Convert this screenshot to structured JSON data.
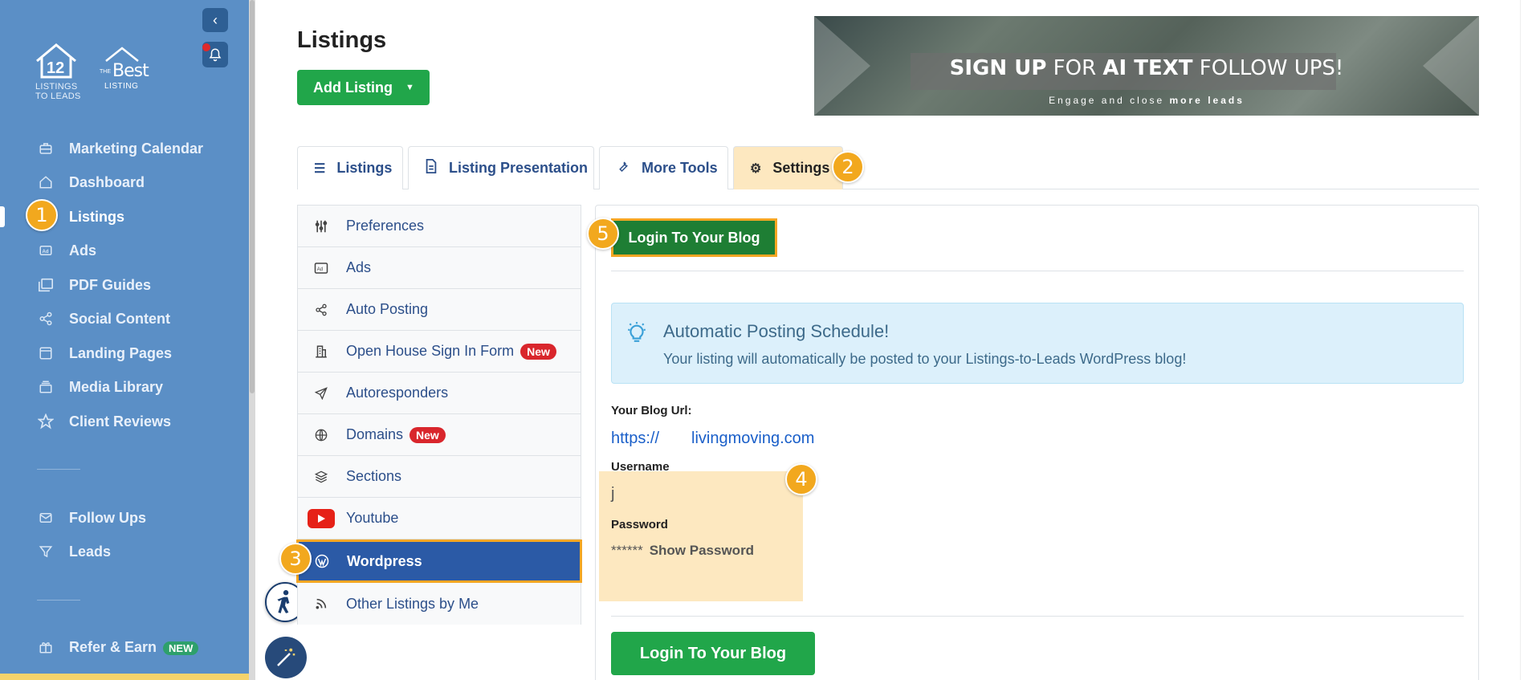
{
  "sidebar": {
    "logo_primary": {
      "number": "12",
      "line1": "LISTINGS",
      "line2": "TO LEADS"
    },
    "logo_secondary": {
      "the": "THE",
      "best": "Best",
      "listing": "LISTING"
    },
    "items": [
      {
        "label": "Marketing Calendar",
        "icon": "briefcase-icon"
      },
      {
        "label": "Dashboard",
        "icon": "home-icon"
      },
      {
        "label": "Listings",
        "icon": "listings-icon"
      },
      {
        "label": "Ads",
        "icon": "ad-icon"
      },
      {
        "label": "PDF Guides",
        "icon": "pdf-icon"
      },
      {
        "label": "Social Content",
        "icon": "share-icon"
      },
      {
        "label": "Landing Pages",
        "icon": "page-icon"
      },
      {
        "label": "Media Library",
        "icon": "folder-icon"
      },
      {
        "label": "Client Reviews",
        "icon": "star-icon"
      },
      {
        "label": "Follow Ups",
        "icon": "mail-icon"
      },
      {
        "label": "Leads",
        "icon": "filter-icon"
      },
      {
        "label": "Refer & Earn",
        "icon": "gift-icon",
        "badge": "NEW"
      }
    ],
    "active_item": "Listings"
  },
  "header": {
    "title": "Listings",
    "add_button": "Add Listing"
  },
  "banner": {
    "headline_bold1": "SIGN UP",
    "headline_mid": " FOR ",
    "headline_bold2": "AI TEXT",
    "headline_end": " FOLLOW UPS!",
    "sub_prefix": "Engage and close ",
    "sub_bold": "more leads"
  },
  "tabs": [
    {
      "label": "Listings",
      "icon": "list-icon"
    },
    {
      "label": "Listing Presentation",
      "icon": "document-icon"
    },
    {
      "label": "More Tools",
      "icon": "wrench-icon"
    },
    {
      "label": "Settings",
      "icon": "gear-icon"
    }
  ],
  "active_tab": "Settings",
  "settings_menu": [
    {
      "label": "Preferences",
      "icon": "sliders-icon"
    },
    {
      "label": "Ads",
      "icon": "ad-icon"
    },
    {
      "label": "Auto Posting",
      "icon": "share-icon"
    },
    {
      "label": "Open House Sign In Form",
      "icon": "building-icon",
      "badge": "New"
    },
    {
      "label": "Autoresponders",
      "icon": "send-icon"
    },
    {
      "label": "Domains",
      "icon": "globe-icon",
      "badge": "New"
    },
    {
      "label": "Sections",
      "icon": "layers-icon"
    },
    {
      "label": "Youtube",
      "icon": "youtube-icon"
    },
    {
      "label": "Wordpress",
      "icon": "wordpress-icon"
    },
    {
      "label": "Other Listings by Me",
      "icon": "rss-icon"
    }
  ],
  "active_menu": "Wordpress",
  "panel": {
    "login_button": "Login To Your Blog",
    "alert_title": "Automatic Posting Schedule!",
    "alert_text": "Your listing will automatically be posted to your Listings-to-Leads WordPress blog!",
    "blog_url_label": "Your Blog Url:",
    "blog_url_prefix": "https://",
    "blog_url_domain": "livingmoving.com",
    "username_label": "Username",
    "username_value": "j",
    "password_label": "Password",
    "password_value": "******",
    "show_password": "Show Password"
  },
  "callouts": [
    "1",
    "2",
    "3",
    "4",
    "5"
  ],
  "colors": {
    "sidebar": "#5b8fc6",
    "accent_green": "#21a64a",
    "highlight": "#f5a623",
    "active_menu": "#2b5aa6"
  }
}
